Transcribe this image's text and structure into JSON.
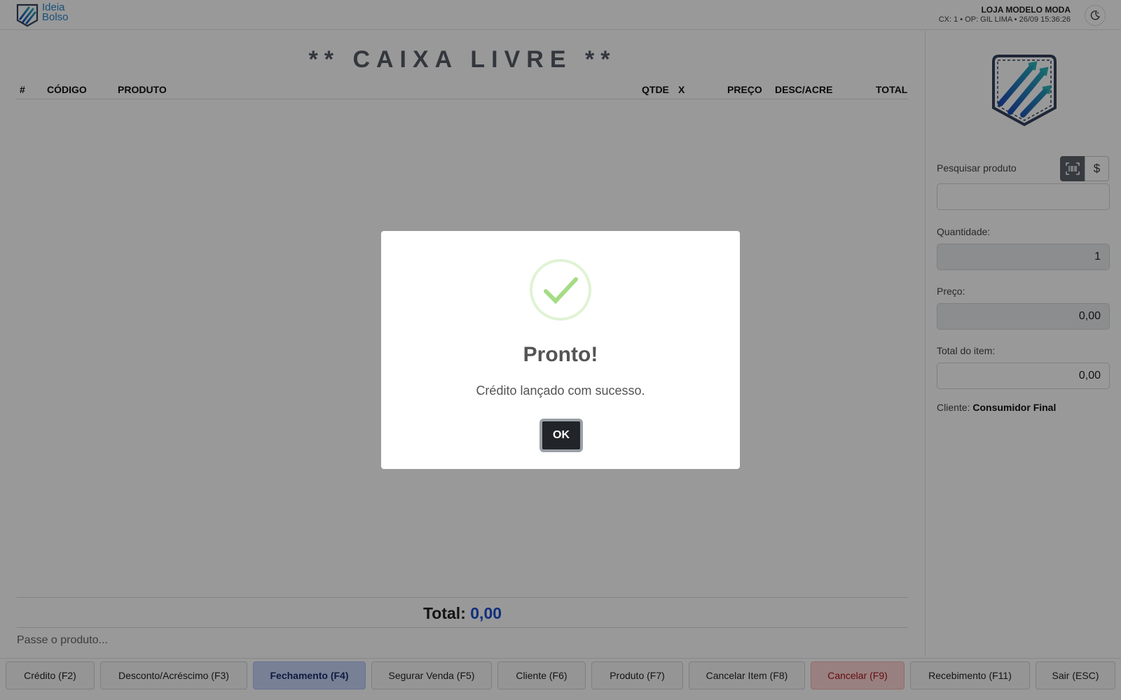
{
  "header": {
    "brand_line1": "Ideia",
    "brand_line2": "Bolso",
    "store_name": "LOJA MODELO MODA",
    "store_info": "CX: 1 • OP: GIL LIMA • 26/09 15:36:26",
    "theme_icon": "moon-icon"
  },
  "sale": {
    "title": "** CAIXA LIVRE **",
    "columns": [
      "#",
      "CÓDIGO",
      "PRODUTO",
      "QTDE",
      "X",
      "PREÇO",
      "DESC/ACRE",
      "TOTAL"
    ],
    "total_label": "Total:",
    "total_value": "0,00",
    "scan_hint": "Passe o produto..."
  },
  "side": {
    "search_label": "Pesquisar produto",
    "search_value": "",
    "quantity_label": "Quantidade:",
    "quantity_value": "1",
    "price_label": "Preço:",
    "price_value": "0,00",
    "item_total_label": "Total do item:",
    "item_total_value": "0,00",
    "client_label": "Cliente:",
    "client_value": "Consumidor Final",
    "barcode_icon": "barcode-icon",
    "dollar_label": "$"
  },
  "toolbar": {
    "buttons": [
      {
        "label": "Crédito (F2)"
      },
      {
        "label": "Desconto/Acréscimo (F3)"
      },
      {
        "label": "Fechamento (F4)"
      },
      {
        "label": "Segurar Venda (F5)"
      },
      {
        "label": "Cliente (F6)"
      },
      {
        "label": "Produto (F7)"
      },
      {
        "label": "Cancelar Item (F8)"
      },
      {
        "label": "Cancelar (F9)"
      },
      {
        "label": "Recebimento (F11)"
      },
      {
        "label": "Sair (ESC)"
      }
    ]
  },
  "modal": {
    "icon": "success-check-icon",
    "title": "Pronto!",
    "text": "Crédito lançado com sucesso.",
    "ok_label": "OK"
  },
  "colors": {
    "accent_total": "#1b4fd1",
    "success": "#a5dc86",
    "danger_bg": "#ffd6d6",
    "primary_bg": "#c9d6fb"
  }
}
